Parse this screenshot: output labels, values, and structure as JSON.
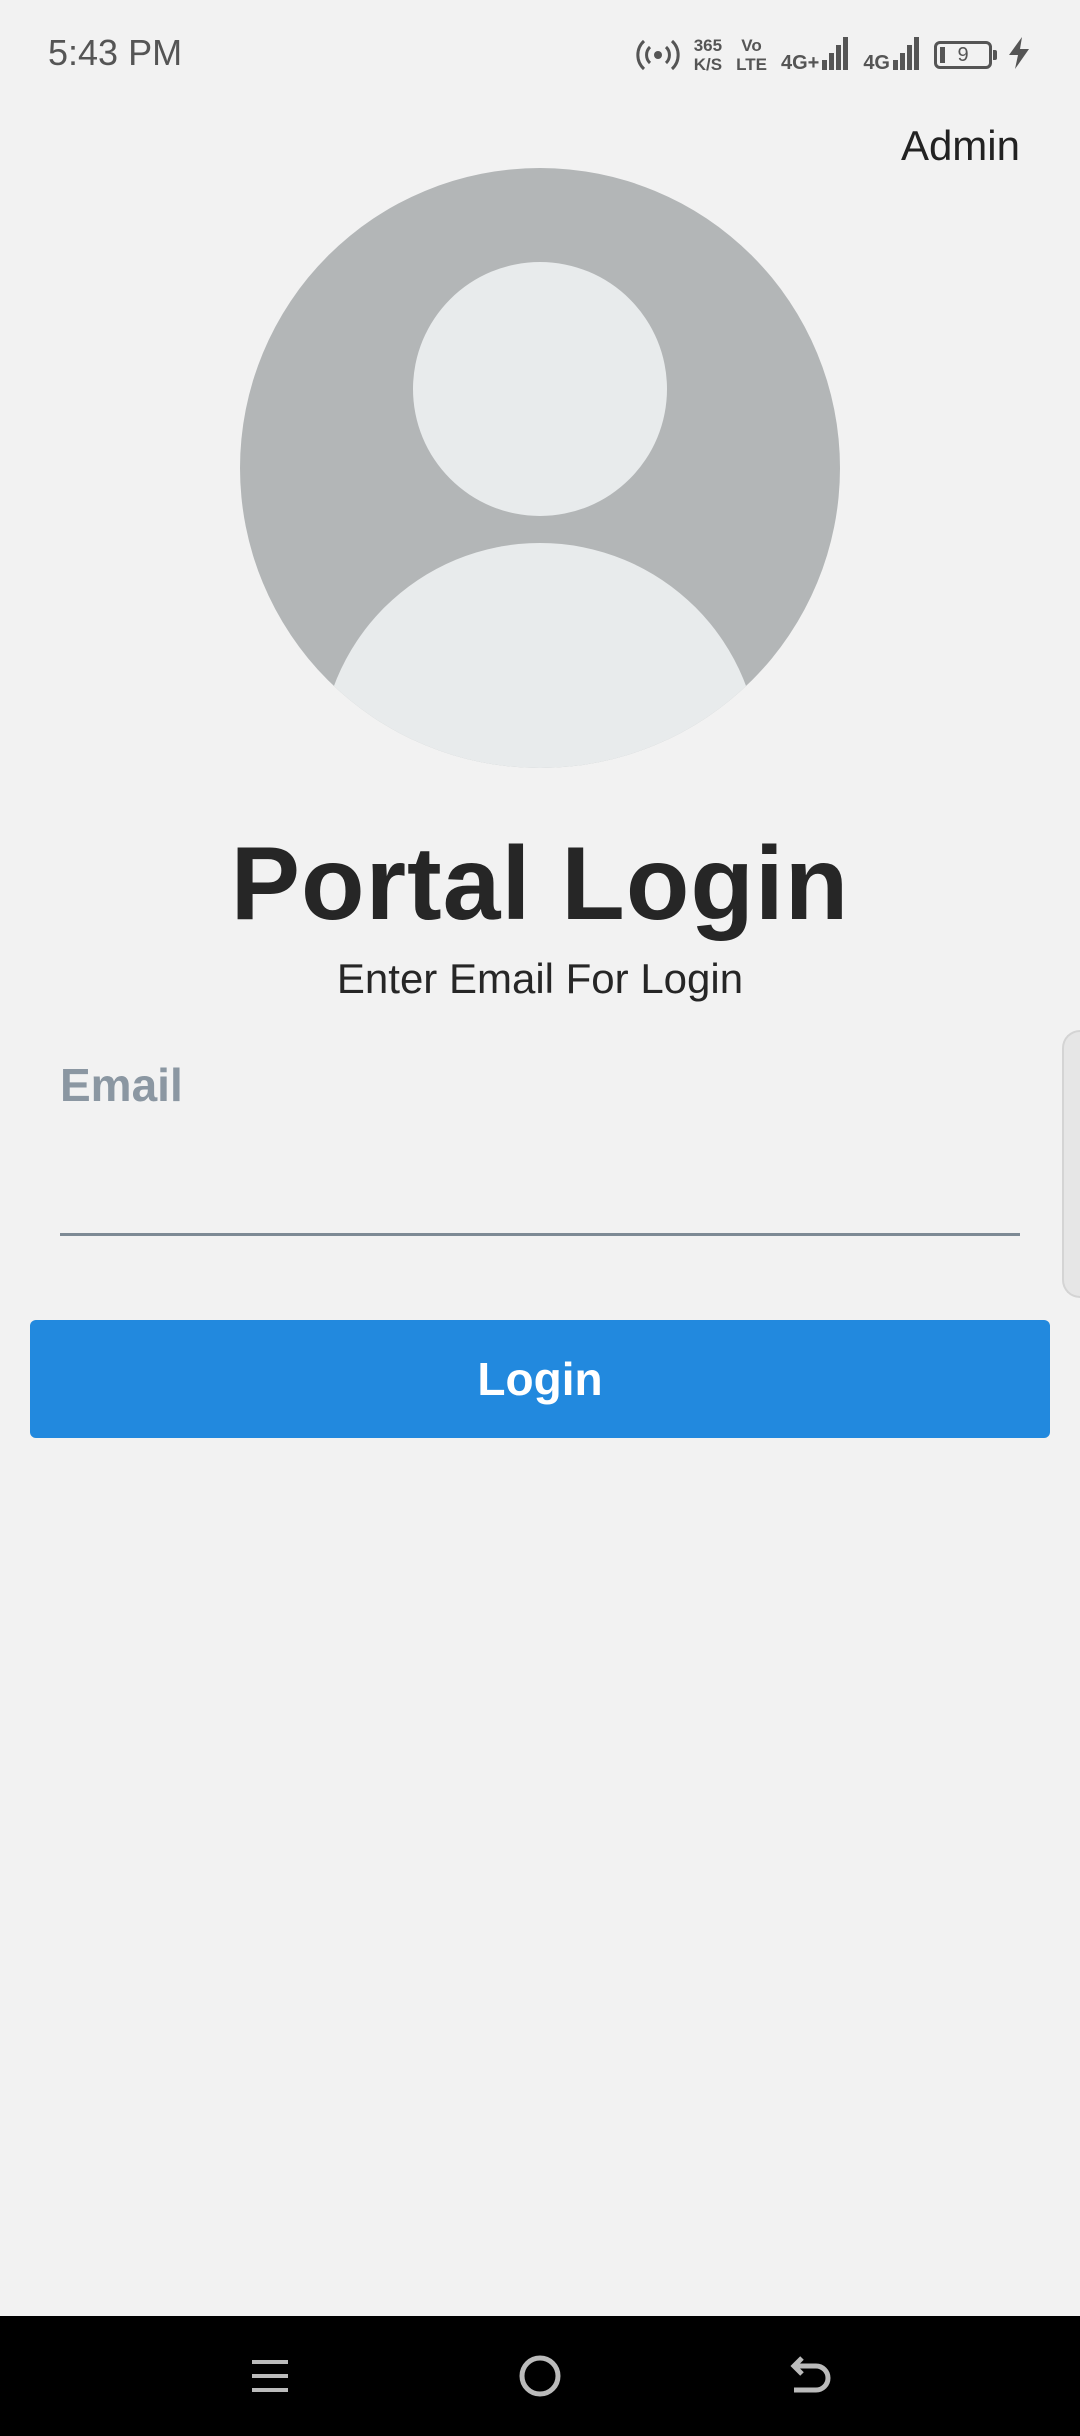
{
  "status_bar": {
    "time": "5:43 PM",
    "net_speed_value": "365",
    "net_speed_unit": "K/S",
    "volte_top": "Vo",
    "volte_bottom": "LTE",
    "network_1": "4G+",
    "network_2": "4G",
    "battery_level": "9",
    "icons": [
      "hotspot-icon",
      "signal-icon",
      "signal-icon",
      "battery-icon",
      "charging-icon"
    ]
  },
  "header": {
    "admin_link": "Admin"
  },
  "main": {
    "title": "Portal Login",
    "subtitle": "Enter Email For Login",
    "email_label": "Email",
    "email_value": "",
    "login_button": "Login"
  },
  "colors": {
    "background": "#f2f2f2",
    "primary_button": "#2289de",
    "label": "#8b97a2",
    "avatar_bg": "#b3b6b7",
    "avatar_fg": "#e8ebec",
    "nav_bar": "#000000"
  },
  "nav_bar": {
    "buttons": [
      "menu-icon",
      "home-icon",
      "back-icon"
    ]
  }
}
